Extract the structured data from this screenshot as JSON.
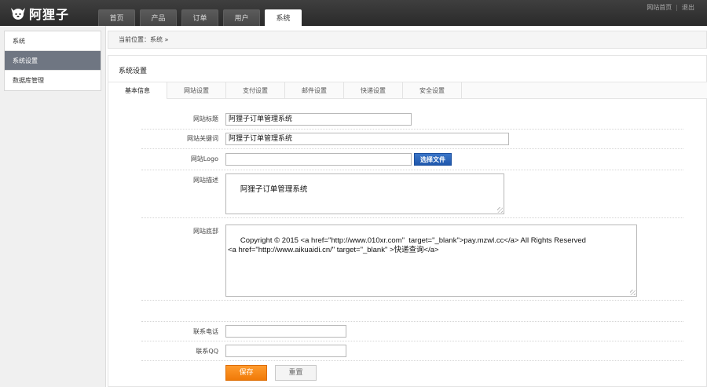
{
  "app": {
    "logo_text": "阿狸子",
    "nav": [
      "首页",
      "产品",
      "订单",
      "用户",
      "系统"
    ],
    "active_nav": "系统",
    "top_links": [
      "网站首页",
      "退出"
    ]
  },
  "sidebar": {
    "items": [
      {
        "label": "系统",
        "active": false
      },
      {
        "label": "系统设置",
        "active": true
      },
      {
        "label": "数据库管理",
        "active": false
      }
    ]
  },
  "breadcrumb": "当前位置：系统 »",
  "panel": {
    "title": "系统设置",
    "tabs": [
      "基本信息",
      "网站设置",
      "支付设置",
      "邮件设置",
      "快递设置",
      "安全设置"
    ],
    "active_tab": "基本信息"
  },
  "form": {
    "site_title": {
      "label": "网站标题",
      "value": "阿狸子订单管理系统"
    },
    "site_keywords": {
      "label": "网站关键词",
      "value": "阿狸子订单管理系统"
    },
    "site_logo": {
      "label": "网站Logo",
      "value": "",
      "button": "选择文件"
    },
    "site_description": {
      "label": "网站描述",
      "value": "阿狸子订单管理系统"
    },
    "site_footer": {
      "label": "网站底部",
      "value": "Copyright © 2015 <a href=\"http://www.010xr.com\"  target=\"_blank\">pay.mzwl.cc</a> All Rights Reserved\n<a href=\"http://www.aikuaidi.cn/\" target=\"_blank\" >快递查询</a>"
    },
    "contact_phone": {
      "label": "联系电话",
      "value": ""
    },
    "contact_qq": {
      "label": "联系QQ",
      "value": ""
    },
    "save_label": "保存",
    "reset_label": "重置"
  }
}
